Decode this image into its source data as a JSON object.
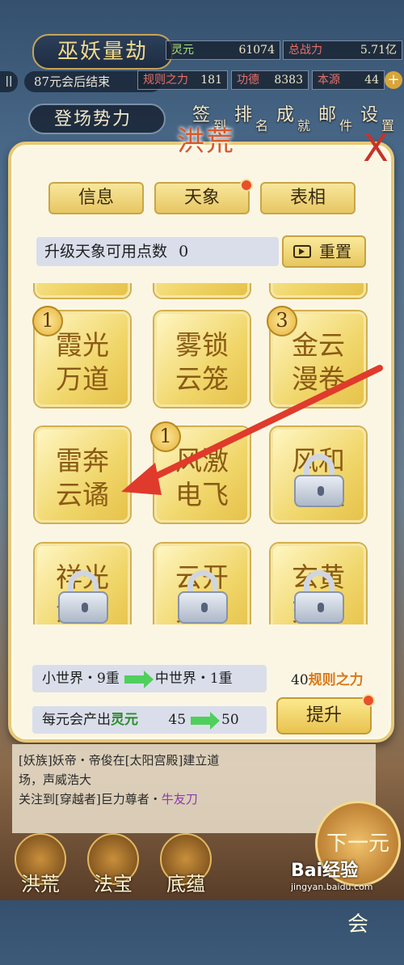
{
  "hud": {
    "title": "巫妖量劫",
    "countdown": "87元会后结束",
    "faction": "登场势力",
    "stats": [
      {
        "label": "灵元",
        "value": "61074"
      },
      {
        "label": "总战力",
        "value": "5.71亿"
      },
      {
        "label": "规则之力",
        "value": "181"
      },
      {
        "label": "功德",
        "value": "8383"
      },
      {
        "label": "本源",
        "value": "44"
      }
    ],
    "top_buttons": [
      {
        "label": "签",
        "sub": "到"
      },
      {
        "label": "排",
        "sub": "名"
      },
      {
        "label": "成",
        "sub": "就"
      },
      {
        "label": "邮",
        "sub": "件"
      },
      {
        "label": "设",
        "sub": "置"
      }
    ]
  },
  "panel": {
    "title": "洪荒",
    "close": "X",
    "tabs": [
      "信息",
      "天象",
      "表相"
    ],
    "points_label": "升级天象可用点数",
    "points_value": "0",
    "reset_label": "重置",
    "tiles": [
      {
        "text": "霞光万道",
        "badge": "1",
        "locked": false
      },
      {
        "text": "雾锁云笼",
        "badge": "",
        "locked": false
      },
      {
        "text": "金云漫卷",
        "badge": "3",
        "locked": false
      },
      {
        "text": "雷奔云谲",
        "badge": "",
        "locked": false
      },
      {
        "text": "风激电飞",
        "badge": "1",
        "locked": false
      },
      {
        "text": "风和日暖",
        "badge": "",
        "locked": true
      },
      {
        "text": "祥光流转",
        "badge": "",
        "locked": true
      },
      {
        "text": "云开见月",
        "badge": "",
        "locked": true
      },
      {
        "text": "玄黄交错",
        "badge": "",
        "locked": true
      }
    ],
    "world_from": "小世界・9重",
    "world_to": "中世界・1重",
    "cost_value": "40",
    "cost_unit": "规则之力",
    "produce_label": "每元会产出",
    "produce_resource": "灵元",
    "produce_from": "45",
    "produce_to": "50",
    "upgrade_label": "提升"
  },
  "log": {
    "line1": "[妖族]妖帝・帝俊在[太阳宫殿]建立道",
    "line2": "场，声威浩大",
    "line3_prefix": "关注到[穿越者]巨力尊者・",
    "line3_name": "牛友刀"
  },
  "bottom_nav": [
    "洪荒",
    "法宝",
    "底蕴"
  ],
  "next_button": "下一元会",
  "watermark": {
    "brand": "Bai经验",
    "url": "jingyan.baidu.com"
  },
  "colors": {
    "accent": "#e6c879",
    "arrow": "#e03a2c",
    "title": "#d45a2c",
    "resource": "#2e8b2e"
  }
}
